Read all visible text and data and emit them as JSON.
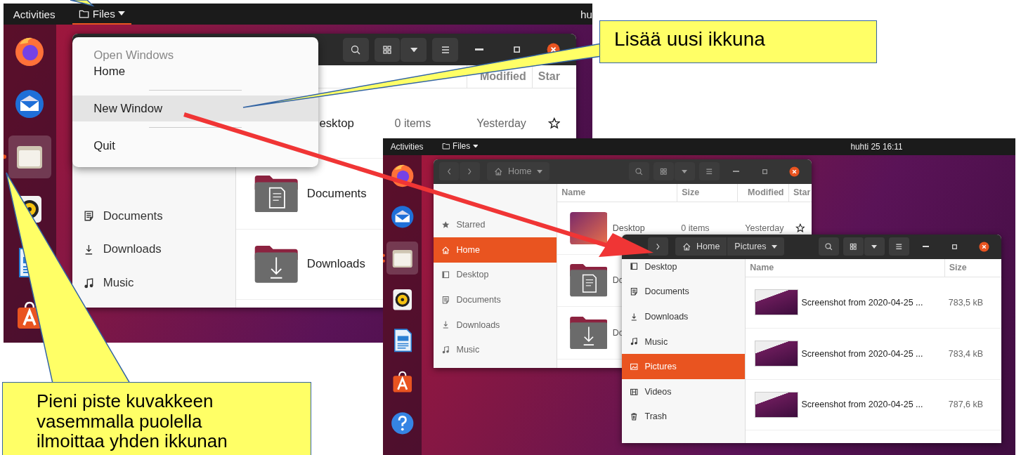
{
  "left_screenshot": {
    "top_bar": {
      "activities": "Activities",
      "app_menu": "Files",
      "menu_open": true,
      "clock": "hu"
    },
    "dock": [
      {
        "kind": "firefox",
        "focused": false,
        "running": false
      },
      {
        "kind": "thunderbird",
        "focused": false,
        "running": false
      },
      {
        "kind": "files",
        "focused": true,
        "running": true,
        "multiple": false
      },
      {
        "kind": "rhythmbox",
        "focused": false,
        "running": false
      },
      {
        "kind": "writer",
        "focused": false,
        "running": false
      },
      {
        "kind": "software",
        "focused": false,
        "running": false
      }
    ],
    "window": {
      "sidebar": [
        {
          "kind": "document",
          "label": "Documents",
          "selected": false
        },
        {
          "kind": "download",
          "label": "Downloads",
          "selected": false
        },
        {
          "kind": "music",
          "label": "Music",
          "selected": false
        }
      ],
      "columns": [
        {
          "kind": "modified",
          "label": "Modified"
        },
        {
          "kind": "star",
          "label": "Star"
        }
      ],
      "rows": [
        {
          "name": "esktop",
          "size": "0 items",
          "modified": "Yesterday",
          "starred": false
        },
        {
          "kind": "folder-documents",
          "name": "Documents"
        },
        {
          "kind": "folder-downloads",
          "name": "Downloads"
        }
      ]
    },
    "menu": {
      "heading": "Open Windows",
      "items": [
        {
          "label": "Home",
          "selected": false
        },
        {
          "label": "New Window",
          "selected": true
        },
        {
          "label": "Quit",
          "selected": false
        }
      ]
    }
  },
  "right_screenshot": {
    "top_bar": {
      "activities": "Activities",
      "app_menu": "Files",
      "menu_open": false,
      "clock": "huhti 25 16:11"
    },
    "dock": [
      {
        "kind": "firefox",
        "focused": false,
        "running": false
      },
      {
        "kind": "thunderbird",
        "focused": false,
        "running": false
      },
      {
        "kind": "files",
        "focused": true,
        "running": true,
        "multiple": true
      },
      {
        "kind": "rhythmbox",
        "focused": false,
        "running": false
      },
      {
        "kind": "writer",
        "focused": false,
        "running": false
      },
      {
        "kind": "software",
        "focused": false,
        "running": false
      },
      {
        "kind": "help",
        "focused": false,
        "running": false
      }
    ],
    "windows": [
      {
        "path": [
          {
            "label": "Home",
            "home": true
          }
        ],
        "sidebar": [
          {
            "kind": "star",
            "label": "Starred",
            "selected": false
          },
          {
            "kind": "home",
            "label": "Home",
            "selected": true
          },
          {
            "kind": "desktop",
            "label": "Desktop",
            "selected": false
          },
          {
            "kind": "document",
            "label": "Documents",
            "selected": false
          },
          {
            "kind": "download",
            "label": "Downloads",
            "selected": false
          },
          {
            "kind": "music",
            "label": "Music",
            "selected": false
          }
        ],
        "columns": [
          {
            "kind": "name",
            "label": "Name"
          },
          {
            "kind": "size",
            "label": "Size"
          },
          {
            "kind": "modified",
            "label": "Modified"
          },
          {
            "kind": "star",
            "label": "Star"
          }
        ],
        "rows": [
          {
            "kind": "folder-desktop",
            "name": "Desktop",
            "size": "0 items",
            "modified": "Yesterday",
            "starred": false
          },
          {
            "kind": "folder-documents",
            "name": "Do"
          },
          {
            "kind": "folder-downloads",
            "name": "Do"
          }
        ]
      },
      {
        "path": [
          {
            "label": "Home",
            "home": true
          },
          {
            "label": "Pictures",
            "home": false
          }
        ],
        "sidebar": [
          {
            "kind": "desktop",
            "label": "Desktop",
            "selected": false
          },
          {
            "kind": "document",
            "label": "Documents",
            "selected": false
          },
          {
            "kind": "download",
            "label": "Downloads",
            "selected": false
          },
          {
            "kind": "music",
            "label": "Music",
            "selected": false
          },
          {
            "kind": "pictures",
            "label": "Pictures",
            "selected": true
          },
          {
            "kind": "videos",
            "label": "Videos",
            "selected": false
          },
          {
            "kind": "trash",
            "label": "Trash",
            "selected": false
          }
        ],
        "columns": [
          {
            "kind": "name",
            "label": "Name"
          },
          {
            "kind": "size",
            "label": "Size"
          }
        ],
        "rows": [
          {
            "kind": "screenshot",
            "name": "Screenshot from 2020-04-25 ...",
            "size": "783,5 kB"
          },
          {
            "kind": "screenshot",
            "name": "Screenshot from 2020-04-25 ...",
            "size": "783,4 kB"
          },
          {
            "kind": "screenshot",
            "name": "Screenshot from 2020-04-25 ...",
            "size": "787,6 kB"
          }
        ]
      }
    ]
  },
  "callouts": [
    {
      "text": "Lisää uusi ikkuna"
    },
    {
      "text": "Pieni piste kuvakkeen vasemmalla puolella ilmoittaa yhden ikkunan"
    }
  ]
}
